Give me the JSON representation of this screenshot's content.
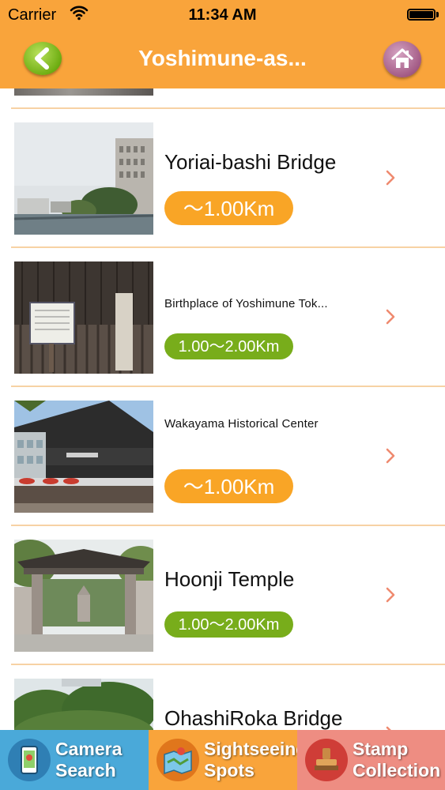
{
  "status_bar": {
    "carrier": "Carrier",
    "time": "11:34 AM"
  },
  "nav": {
    "title": "Yoshimune-as...",
    "back_icon": "chevron-left-icon",
    "home_icon": "home-icon"
  },
  "spots": [
    {
      "name": "Yoriai-bashi Bridge",
      "distance": "～1.00Km",
      "badge_color": "#f9a526"
    },
    {
      "name": "Birthplace of Yoshimune Tok...",
      "distance": "1.00～2.00Km",
      "badge_color": "#78ad1b"
    },
    {
      "name": "Wakayama Historical Center",
      "distance": "～1.00Km",
      "badge_color": "#f9a526"
    },
    {
      "name": "Hoonji Temple",
      "distance": "1.00～2.00Km",
      "badge_color": "#78ad1b"
    },
    {
      "name": "OhashiRoka Bridge"
    }
  ],
  "tabs": [
    {
      "label_line1": "Camera",
      "label_line2": "Search",
      "color": "#4aa9d9"
    },
    {
      "label_line1": "Sightseeing",
      "label_line2": "Spots",
      "color": "#f9a43b"
    },
    {
      "label_line1": "Stamp",
      "label_line2": "Collection",
      "color": "#ee8d82"
    }
  ],
  "colors": {
    "header": "#f9a43b",
    "divider": "#f7d2a4",
    "chevron": "#ef8a6f"
  }
}
